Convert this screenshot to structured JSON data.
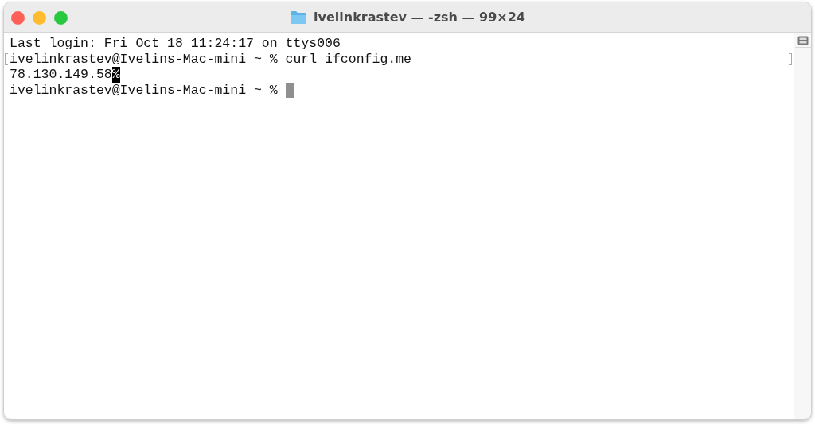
{
  "window": {
    "title": "ivelinkrastev — -zsh — 99×24"
  },
  "lines": [
    {
      "marked": false,
      "cursor": false,
      "segments": [
        {
          "text": "Last login: Fri Oct 18 11:24:17 on ttys006",
          "inverse": false
        }
      ]
    },
    {
      "marked": true,
      "cursor": false,
      "segments": [
        {
          "text": "ivelinkrastev@Ivelins-Mac-mini ~ % curl ifconfig.me",
          "inverse": false
        }
      ]
    },
    {
      "marked": false,
      "cursor": false,
      "segments": [
        {
          "text": "78.130.149.58",
          "inverse": false
        },
        {
          "text": "%",
          "inverse": true
        }
      ]
    },
    {
      "marked": false,
      "cursor": true,
      "segments": [
        {
          "text": "ivelinkrastev@Ivelins-Mac-mini ~ % ",
          "inverse": false
        }
      ]
    }
  ]
}
